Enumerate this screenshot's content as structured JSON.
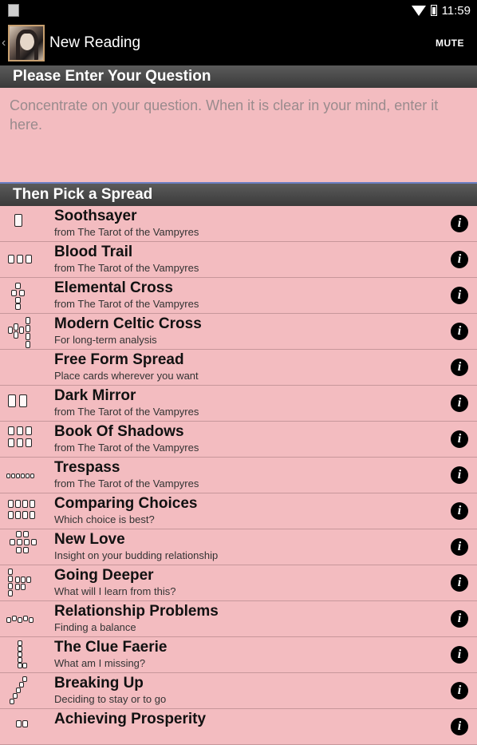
{
  "status": {
    "time": "11:59",
    "icons": [
      "wifi-icon",
      "battery-icon"
    ]
  },
  "actionbar": {
    "title": "New Reading",
    "mute_label": "MUTE"
  },
  "question": {
    "header": "Please Enter Your Question",
    "placeholder": "Concentrate on your question. When it is clear in your mind, enter it here.",
    "value": ""
  },
  "spread": {
    "header": "Then Pick a Spread",
    "items": [
      {
        "title": "Soothsayer",
        "subtitle": "from The Tarot of the Vampyres"
      },
      {
        "title": "Blood Trail",
        "subtitle": "from The Tarot of the Vampyres"
      },
      {
        "title": "Elemental Cross",
        "subtitle": "from The Tarot of the Vampyres"
      },
      {
        "title": "Modern Celtic Cross",
        "subtitle": "For long-term analysis"
      },
      {
        "title": "Free Form Spread",
        "subtitle": "Place cards wherever you want"
      },
      {
        "title": "Dark Mirror",
        "subtitle": "from The Tarot of the Vampyres"
      },
      {
        "title": "Book Of Shadows",
        "subtitle": "from The Tarot of the Vampyres"
      },
      {
        "title": "Trespass",
        "subtitle": "from The Tarot of the Vampyres"
      },
      {
        "title": "Comparing Choices",
        "subtitle": "Which choice is best?"
      },
      {
        "title": "New Love",
        "subtitle": "Insight on your budding relationship"
      },
      {
        "title": "Going Deeper",
        "subtitle": "What will I learn from this?"
      },
      {
        "title": "Relationship Problems",
        "subtitle": "Finding a balance"
      },
      {
        "title": "The Clue Faerie",
        "subtitle": "What am I missing?"
      },
      {
        "title": "Breaking Up",
        "subtitle": "Deciding to stay or to go"
      },
      {
        "title": "Achieving Prosperity",
        "subtitle": ""
      }
    ]
  },
  "colors": {
    "background": "#f3bcc0",
    "header": "#4a4a4a",
    "actionbar": "#000000"
  }
}
